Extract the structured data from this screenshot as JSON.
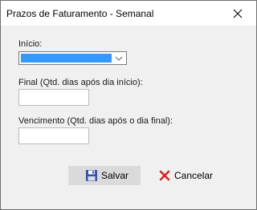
{
  "window": {
    "title": "Prazos de Faturamento - Semanal"
  },
  "fields": {
    "inicio_label": "Início:",
    "final_label": "Final (Qtd. dias após dia início):",
    "final_value": "",
    "vencimento_label": "Vencimento (Qtd. dias após o dia final):",
    "vencimento_value": ""
  },
  "buttons": {
    "save_label": "Salvar",
    "cancel_label": "Cancelar"
  },
  "icons": {
    "close": "close-icon",
    "combo_arrow": "chevron-down-icon",
    "save": "floppy-disk-icon",
    "cancel": "red-x-icon"
  },
  "colors": {
    "selection": "#3399ff",
    "cancel_icon": "#e02020",
    "save_icon": "#3a4fb0"
  }
}
